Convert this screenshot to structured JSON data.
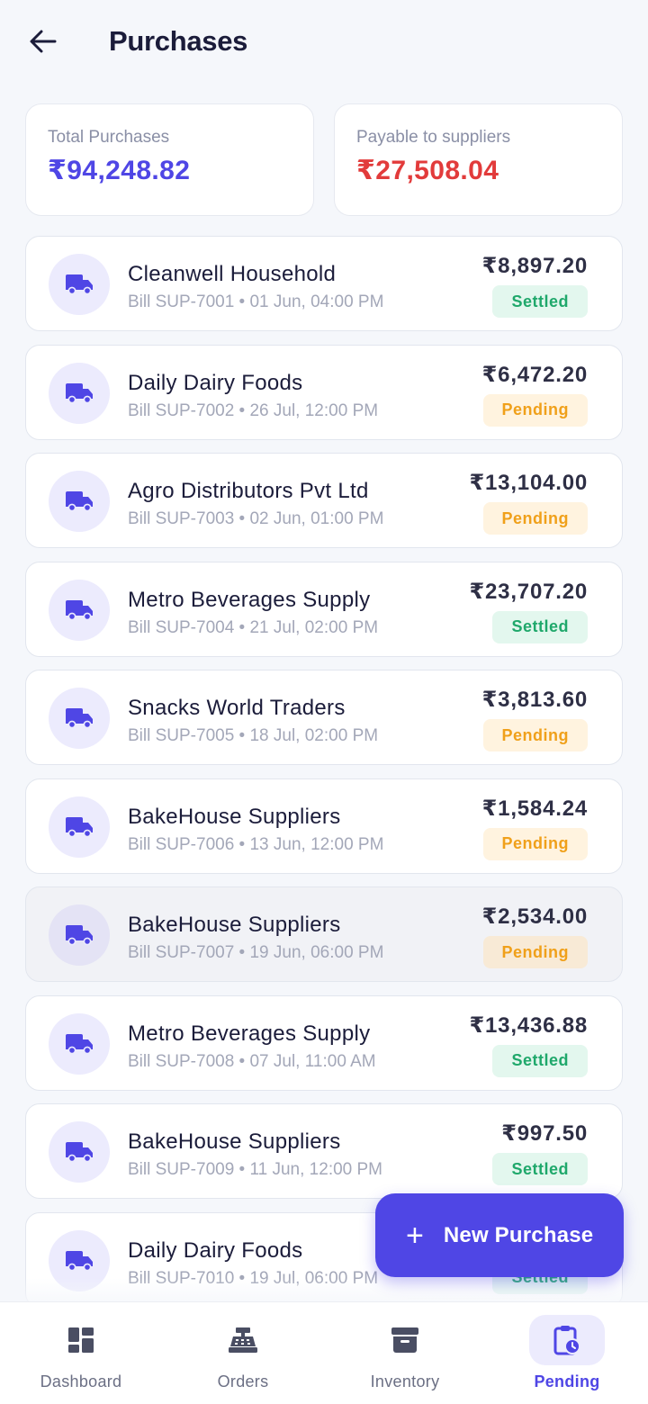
{
  "header": {
    "title": "Purchases",
    "back_icon": "arrow-left-icon"
  },
  "summary": {
    "total": {
      "label": "Total Purchases",
      "value": "₹94,248.82",
      "color": "#4f46e5"
    },
    "payable": {
      "label": "Payable to suppliers",
      "value": "₹27,508.04",
      "color": "#e23b3b"
    }
  },
  "purchases": [
    {
      "supplier": "Cleanwell Household",
      "bill": "Bill SUP-7001 • 01 Jun, 04:00 PM",
      "amount": "₹8,897.20",
      "status": "Settled"
    },
    {
      "supplier": "Daily Dairy Foods",
      "bill": "Bill SUP-7002 • 26 Jul, 12:00 PM",
      "amount": "₹6,472.20",
      "status": "Pending"
    },
    {
      "supplier": "Agro Distributors Pvt Ltd",
      "bill": "Bill SUP-7003 • 02 Jun, 01:00 PM",
      "amount": "₹13,104.00",
      "status": "Pending"
    },
    {
      "supplier": "Metro Beverages Supply",
      "bill": "Bill SUP-7004 • 21 Jul, 02:00 PM",
      "amount": "₹23,707.20",
      "status": "Settled"
    },
    {
      "supplier": "Snacks World Traders",
      "bill": "Bill SUP-7005 • 18 Jul, 02:00 PM",
      "amount": "₹3,813.60",
      "status": "Pending"
    },
    {
      "supplier": "BakeHouse Suppliers",
      "bill": "Bill SUP-7006 • 13 Jun, 12:00 PM",
      "amount": "₹1,584.24",
      "status": "Pending"
    },
    {
      "supplier": "BakeHouse Suppliers",
      "bill": "Bill SUP-7007 • 19 Jun, 06:00 PM",
      "amount": "₹2,534.00",
      "status": "Pending"
    },
    {
      "supplier": "Metro Beverages Supply",
      "bill": "Bill SUP-7008 • 07 Jul, 11:00 AM",
      "amount": "₹13,436.88",
      "status": "Settled"
    },
    {
      "supplier": "BakeHouse Suppliers",
      "bill": "Bill SUP-7009 • 11 Jun, 12:00 PM",
      "amount": "₹997.50",
      "status": "Settled"
    },
    {
      "supplier": "Daily Dairy Foods",
      "bill": "Bill SUP-7010 • 19 Jul, 06:00 PM",
      "amount": "",
      "status": "Settled"
    }
  ],
  "fab": {
    "icon": "plus-icon",
    "label": "New Purchase"
  },
  "nav": {
    "items": [
      {
        "label": "Dashboard",
        "icon": "dashboard-icon"
      },
      {
        "label": "Orders",
        "icon": "cash-register-icon"
      },
      {
        "label": "Inventory",
        "icon": "archive-box-icon"
      },
      {
        "label": "Pending",
        "icon": "clipboard-clock-icon"
      }
    ]
  },
  "colors": {
    "accent": "#4f46e5",
    "pending": "#f0a01a",
    "settled": "#1fa86b",
    "payable": "#e23b3b"
  }
}
